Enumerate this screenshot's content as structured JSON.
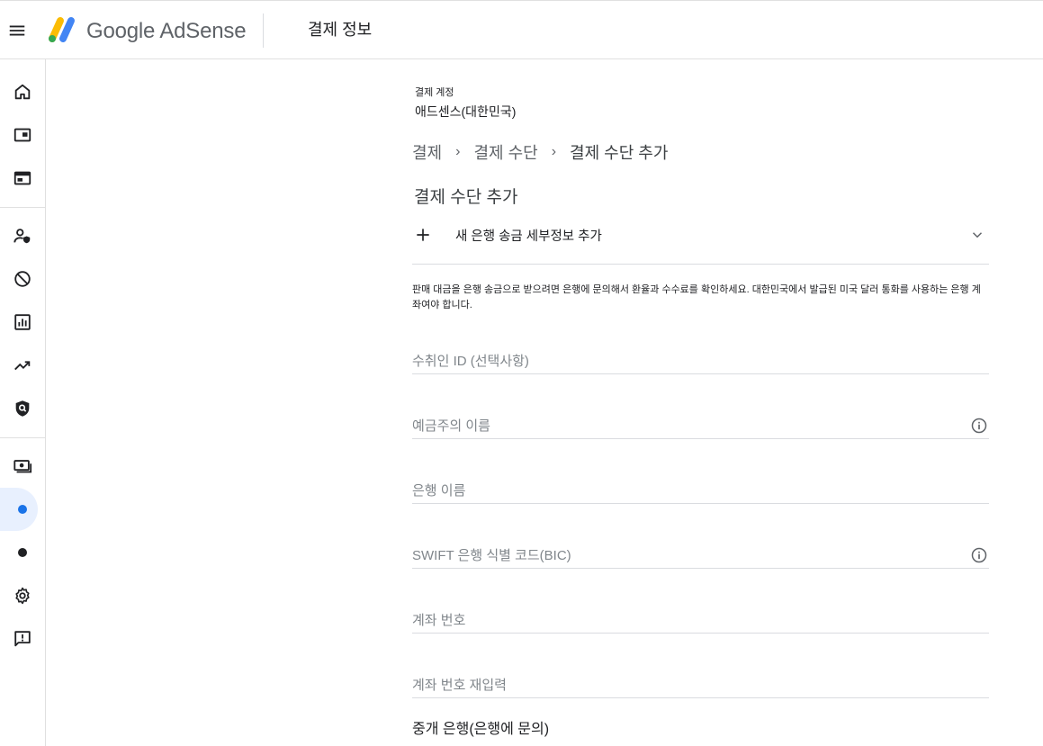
{
  "app": {
    "product_name": "Google AdSense",
    "page_title": "결제 정보"
  },
  "colors": {
    "logo_yellow": "#fbbc04",
    "logo_blue": "#4285f4",
    "logo_green": "#34a853",
    "active_nav_bg": "#e8f0fe",
    "active_dot": "#1a73e8"
  },
  "sidebar": {
    "items": [
      {
        "icon": "home-icon"
      },
      {
        "icon": "ads-icon"
      },
      {
        "icon": "sites-icon"
      },
      {
        "icon": "privacy-messaging-icon"
      },
      {
        "icon": "blocking-controls-icon"
      },
      {
        "icon": "reports-icon"
      },
      {
        "icon": "optimization-icon"
      },
      {
        "icon": "policy-center-icon"
      },
      {
        "icon": "payments-icon"
      },
      {
        "icon": "payments-info-dot",
        "active": true
      },
      {
        "icon": "transactions-dot"
      },
      {
        "icon": "settings-icon"
      },
      {
        "icon": "feedback-icon"
      }
    ]
  },
  "account": {
    "label": "결제 계정",
    "name": "애드센스(대한민국)"
  },
  "breadcrumb": {
    "items": [
      "결제",
      "결제 수단",
      "결제 수단 추가"
    ],
    "separator": "›"
  },
  "section_title": "결제 수단 추가",
  "expander": {
    "label": "새 은행 송금 세부정보 추가"
  },
  "info_text": "판매 대금을 은행 송금으로 받으려면 은행에 문의해서 환율과 수수료를 확인하세요. 대한민국에서 발급된 미국 달러 통화를 사용하는 은행 계좌여야 합니다.",
  "form": {
    "payee_id": {
      "placeholder": "수취인 ID (선택사항)",
      "value": ""
    },
    "account_holder": {
      "placeholder": "예금주의 이름",
      "value": ""
    },
    "bank_name": {
      "placeholder": "은행 이름",
      "value": ""
    },
    "swift_code": {
      "placeholder": "SWIFT 은행 식별 코드(BIC)",
      "value": ""
    },
    "account_number": {
      "placeholder": "계좌 번호",
      "value": ""
    },
    "account_number_confirm": {
      "placeholder": "계좌 번호 재입력",
      "value": ""
    }
  },
  "intermediary_bank_label": "중개 은행(은행에 문의)"
}
